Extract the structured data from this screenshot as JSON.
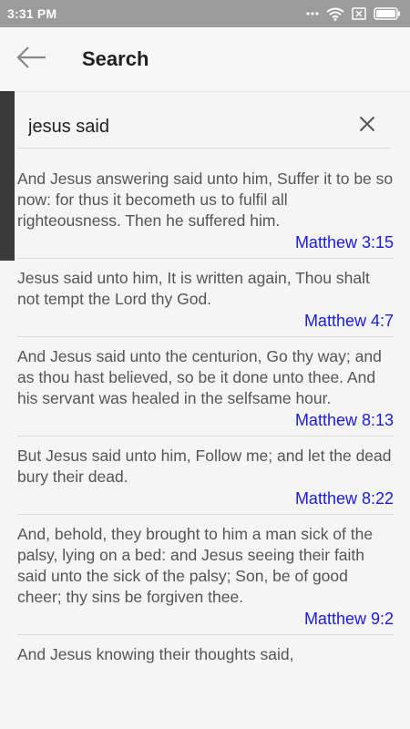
{
  "status_bar": {
    "time": "3:31 PM",
    "battery_level": 1.0
  },
  "header": {
    "title": "Search",
    "back_icon": "arrow-left-icon"
  },
  "search": {
    "value": "jesus said",
    "clear_icon": "close-icon"
  },
  "colors": {
    "reference_link": "#1a1ae6",
    "status_bar": "#9b9b9b",
    "body_text": "#555555"
  },
  "results": [
    {
      "text": "And Jesus answering said unto him, Suffer it to be so now: for thus it becometh us to fulfil all righteousness. Then he suffered him.",
      "reference": "Matthew 3:15"
    },
    {
      "text": "Jesus said unto him, It is written again, Thou shalt not tempt the Lord thy God.",
      "reference": "Matthew 4:7"
    },
    {
      "text": "And Jesus said unto the centurion, Go thy way; and as thou hast believed, so be it done unto thee. And his servant was healed in the selfsame hour.",
      "reference": "Matthew 8:13"
    },
    {
      "text": "But Jesus said unto him, Follow me; and let the dead bury their dead.",
      "reference": "Matthew 8:22"
    },
    {
      "text": "And, behold, they brought to him a man sick of the palsy, lying on a bed: and Jesus seeing their faith said unto the sick of the palsy; Son, be of good cheer; thy sins be forgiven thee.",
      "reference": "Matthew 9:2"
    },
    {
      "text": "And Jesus knowing their thoughts said,",
      "reference": ""
    }
  ]
}
